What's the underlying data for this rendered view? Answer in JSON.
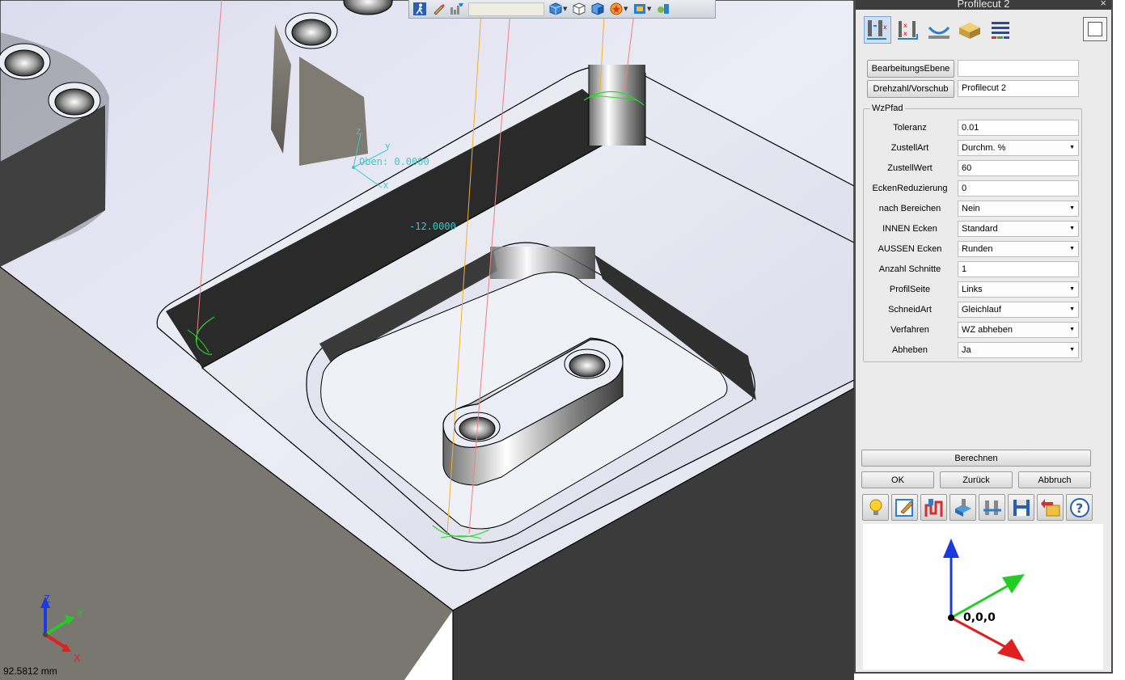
{
  "viewport": {
    "label_top": "Oben: 0.0000",
    "label_depth": "-12.0000",
    "triad_x": "X",
    "triad_y": "Y",
    "triad_z": "Z",
    "small_x": "X",
    "small_y": "Y",
    "small_z": "Z",
    "dimension": "92.5812 mm"
  },
  "toolbar": {
    "icons": [
      "walk-icon",
      "pencil-icon",
      "filter-icon",
      "view-cube-icon",
      "wireframe-cube-icon",
      "shaded-cube-icon",
      "color-wheel-icon",
      "display-mode-icon",
      "light-icon"
    ]
  },
  "panel": {
    "title": "Profilecut 2",
    "close": "×",
    "mode_tabs": [
      "profile-pocket-icon",
      "depth-icon",
      "tool-icon",
      "stock-icon",
      "list-icon"
    ],
    "bearbeitungsebene_label": "BearbeitungsEbene",
    "bearbeitungsebene_value": "",
    "drehzahl_label": "Drehzahl/Vorschub",
    "drehzahl_value": "Profilecut 2",
    "wzpfad_legend": "WzPfad",
    "params": [
      {
        "label": "Toleranz",
        "value": "0.01",
        "select": false
      },
      {
        "label": "ZustellArt",
        "value": "Durchm. %",
        "select": true
      },
      {
        "label": "ZustellWert",
        "value": "60",
        "select": false
      },
      {
        "label": "EckenReduzierung",
        "value": "0",
        "select": false
      },
      {
        "label": "nach Bereichen",
        "value": "Nein",
        "select": true
      },
      {
        "label": "INNEN Ecken",
        "value": "Standard",
        "select": true
      },
      {
        "label": "AUSSEN Ecken",
        "value": "Runden",
        "select": true
      },
      {
        "label": "Anzahl Schnitte",
        "value": "1",
        "select": false
      },
      {
        "label": "ProfilSeite",
        "value": "Links",
        "select": true
      },
      {
        "label": "SchneidArt",
        "value": "Gleichlauf",
        "select": true
      },
      {
        "label": "Verfahren",
        "value": "WZ abheben",
        "select": true
      },
      {
        "label": "Abheben",
        "value": "Ja",
        "select": true
      }
    ],
    "berechnen": "Berechnen",
    "ok": "OK",
    "zurueck": "Zurück",
    "abbruch": "Abbruch",
    "bottom_icons": [
      "lightbulb-icon",
      "edit-icon",
      "toolpath-icon",
      "simulate-icon",
      "settings-icon",
      "save-icon",
      "undo-icon",
      "help-icon"
    ],
    "origin_label": "0,0,0"
  },
  "colors": {
    "part_top": "#e8e8f4",
    "part_side": "#3d3d3d",
    "toolpath_orange": "#f0b030",
    "toolpath_red": "#f08080",
    "entry_green": "#22dd22",
    "axis_cyan": "#33cccc",
    "panel_bg": "#ebebeb"
  }
}
